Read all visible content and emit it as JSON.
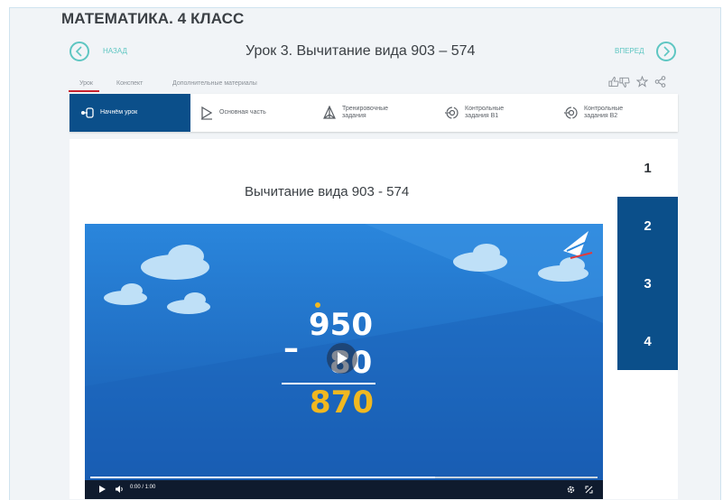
{
  "header": {
    "course_title": "МАТЕМАТИКА. 4 КЛАСС"
  },
  "nav": {
    "back_label": "НАЗАД",
    "forward_label": "ВПЕРЕД"
  },
  "lesson": {
    "title": "Урок 3. Вычитание вида 903 – 574"
  },
  "subtabs": [
    {
      "label": "Урок",
      "active": true
    },
    {
      "label": "Конспект",
      "active": false
    },
    {
      "label": "Дополнительные материалы",
      "active": false
    }
  ],
  "actions": {
    "like_icon": "thumbs-icons",
    "favorite_icon": "star-icon",
    "share_icon": "share-icon"
  },
  "toolbar": {
    "items": [
      {
        "label": "Начнём урок",
        "icon": "start-icon",
        "active": true
      },
      {
        "label": "Основная часть",
        "icon": "play-square-icon",
        "active": false
      },
      {
        "label": "Тренировочные задания",
        "icon": "pyramid-icon",
        "active": false
      },
      {
        "label": "Контрольные задания В1",
        "icon": "target-icon",
        "active": false
      },
      {
        "label": "Контрольные задания В2",
        "icon": "target-icon",
        "active": false
      }
    ]
  },
  "content": {
    "video_caption": "Вычитание вида 903 - 574",
    "steps": [
      "1",
      "2",
      "3",
      "4"
    ],
    "current_step": "1"
  },
  "video": {
    "example_minuend": "950",
    "example_minus": "–",
    "example_subtrahend": "80",
    "example_result": "870",
    "time_display": "0:00 / 1:00",
    "progress_fraction": 0.68,
    "colors": {
      "sky_top": "#2a7fd4",
      "sky_bottom": "#1a5fb4",
      "accent": "#f1b820"
    }
  },
  "colors": {
    "teal": "#5ec6c2",
    "navy": "#0b4f8a",
    "red": "#c8222e"
  }
}
